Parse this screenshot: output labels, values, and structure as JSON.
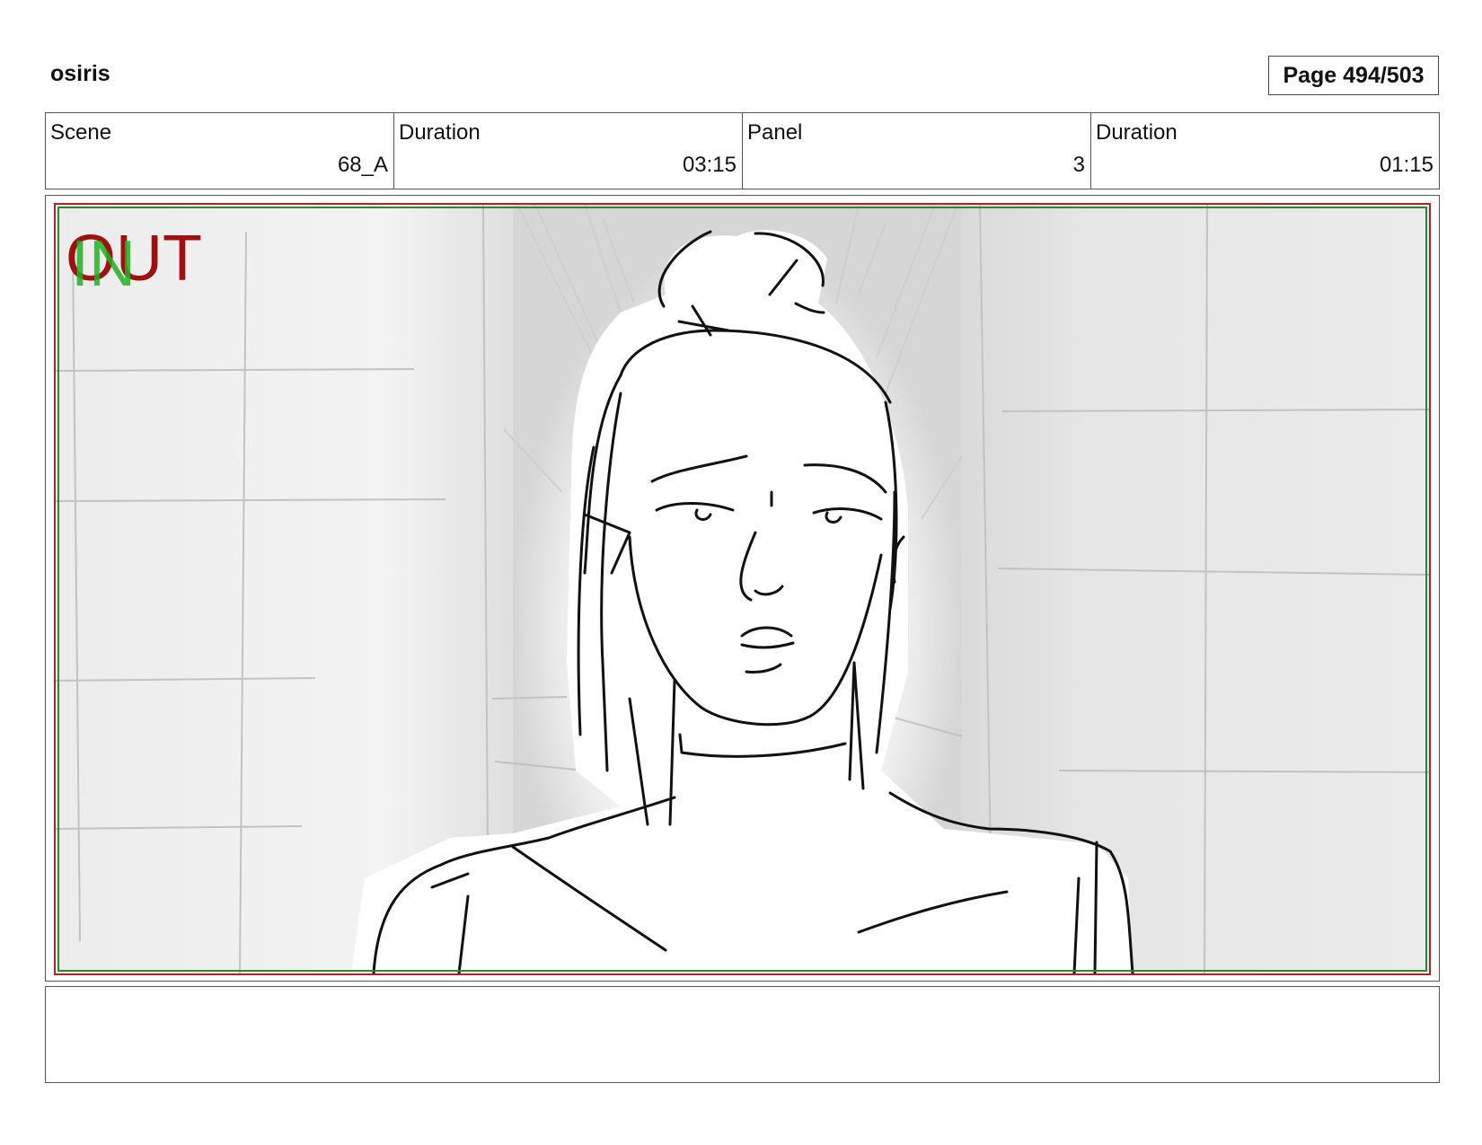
{
  "header": {
    "project": "osiris",
    "page": "Page 494/503"
  },
  "info": [
    {
      "label": "Scene",
      "value": "68_A"
    },
    {
      "label": "Duration",
      "value": "03:15"
    },
    {
      "label": "Panel",
      "value": "3"
    },
    {
      "label": "Duration",
      "value": "01:15"
    }
  ],
  "panel": {
    "overlay_out": "OUT",
    "overlay_in": "IN",
    "colors": {
      "out": "#a01010",
      "in": "#22b022",
      "safe_red": "#b02030",
      "safe_green": "#2a8a2a"
    }
  },
  "notes": {
    "text": ""
  }
}
